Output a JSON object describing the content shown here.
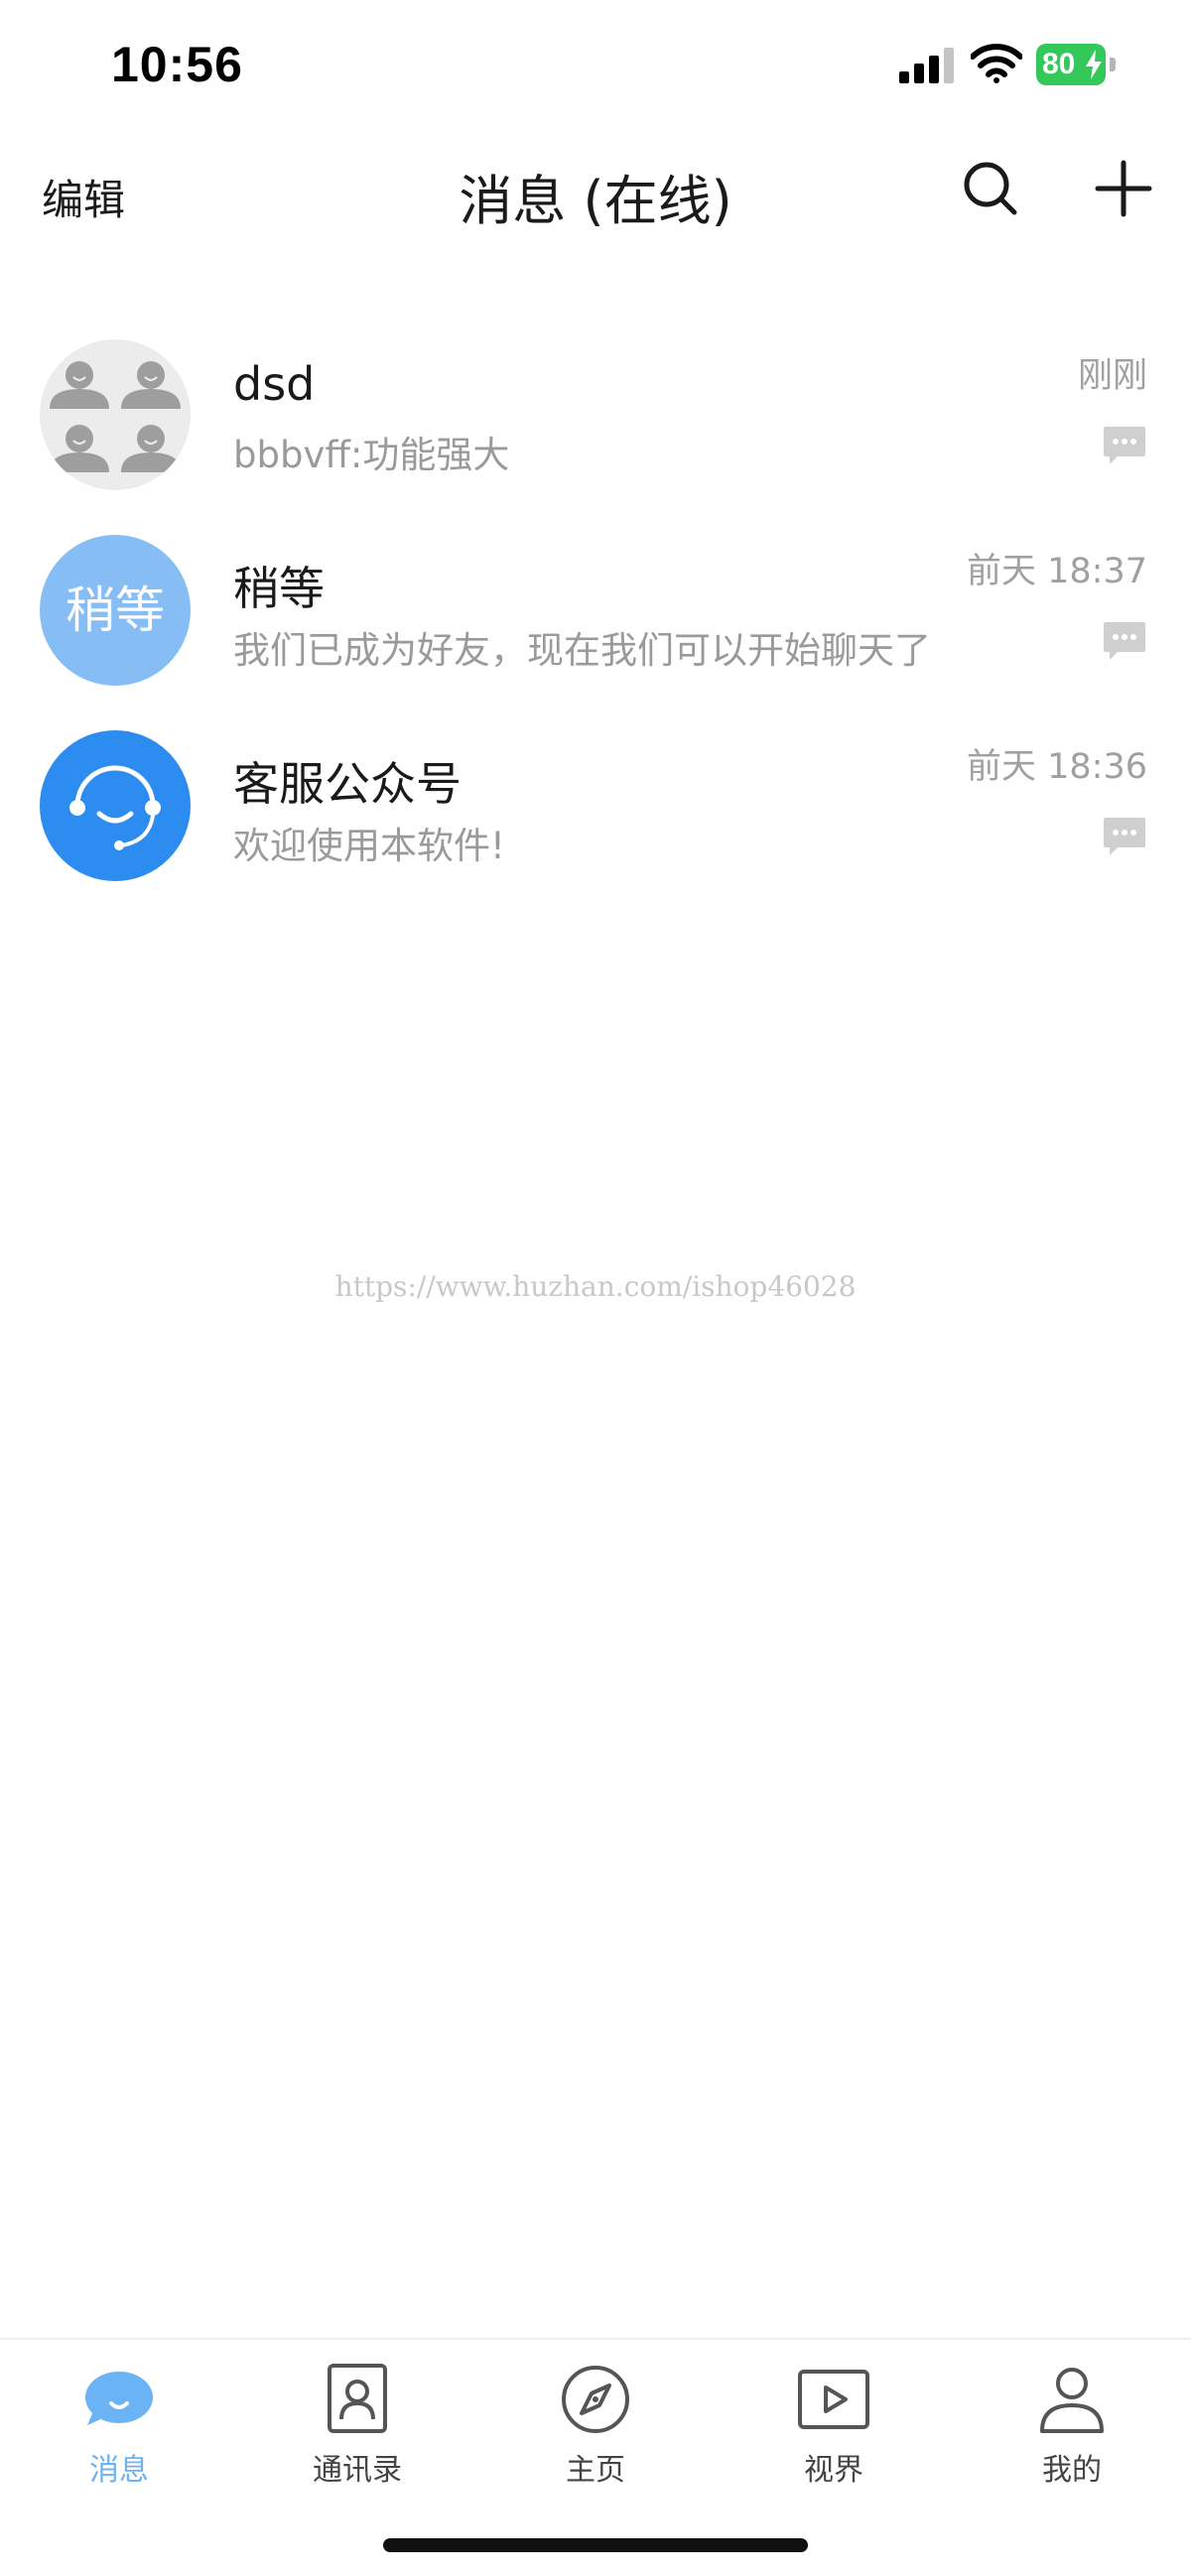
{
  "status_bar": {
    "time": "10:56",
    "battery": "80"
  },
  "nav": {
    "edit_label": "编辑",
    "title": "消息 (在线)"
  },
  "conversations": [
    {
      "name": "dsd",
      "preview": "bbbvff:功能强大",
      "time": "刚刚",
      "avatar_type": "group-icon"
    },
    {
      "name": "稍等",
      "preview": "我们已成为好友，现在我们可以开始聊天了",
      "time": "前天 18:37",
      "avatar_text": "稍等"
    },
    {
      "name": "客服公众号",
      "preview": "欢迎使用本软件!",
      "time": "前天 18:36",
      "avatar_type": "headset-icon"
    }
  ],
  "watermark": "https://www.huzhan.com/ishop46028",
  "tabs": [
    {
      "label": "消息",
      "icon": "chat-bubble-icon",
      "active": true
    },
    {
      "label": "通讯录",
      "icon": "contacts-icon",
      "active": false
    },
    {
      "label": "主页",
      "icon": "compass-icon",
      "active": false
    },
    {
      "label": "视界",
      "icon": "video-icon",
      "active": false
    },
    {
      "label": "我的",
      "icon": "profile-icon",
      "active": false
    }
  ],
  "colors": {
    "accent": "#6ab3f5",
    "service_avatar": "#2d8cf0",
    "text_avatar": "#87bdf5",
    "battery": "#34c759"
  }
}
